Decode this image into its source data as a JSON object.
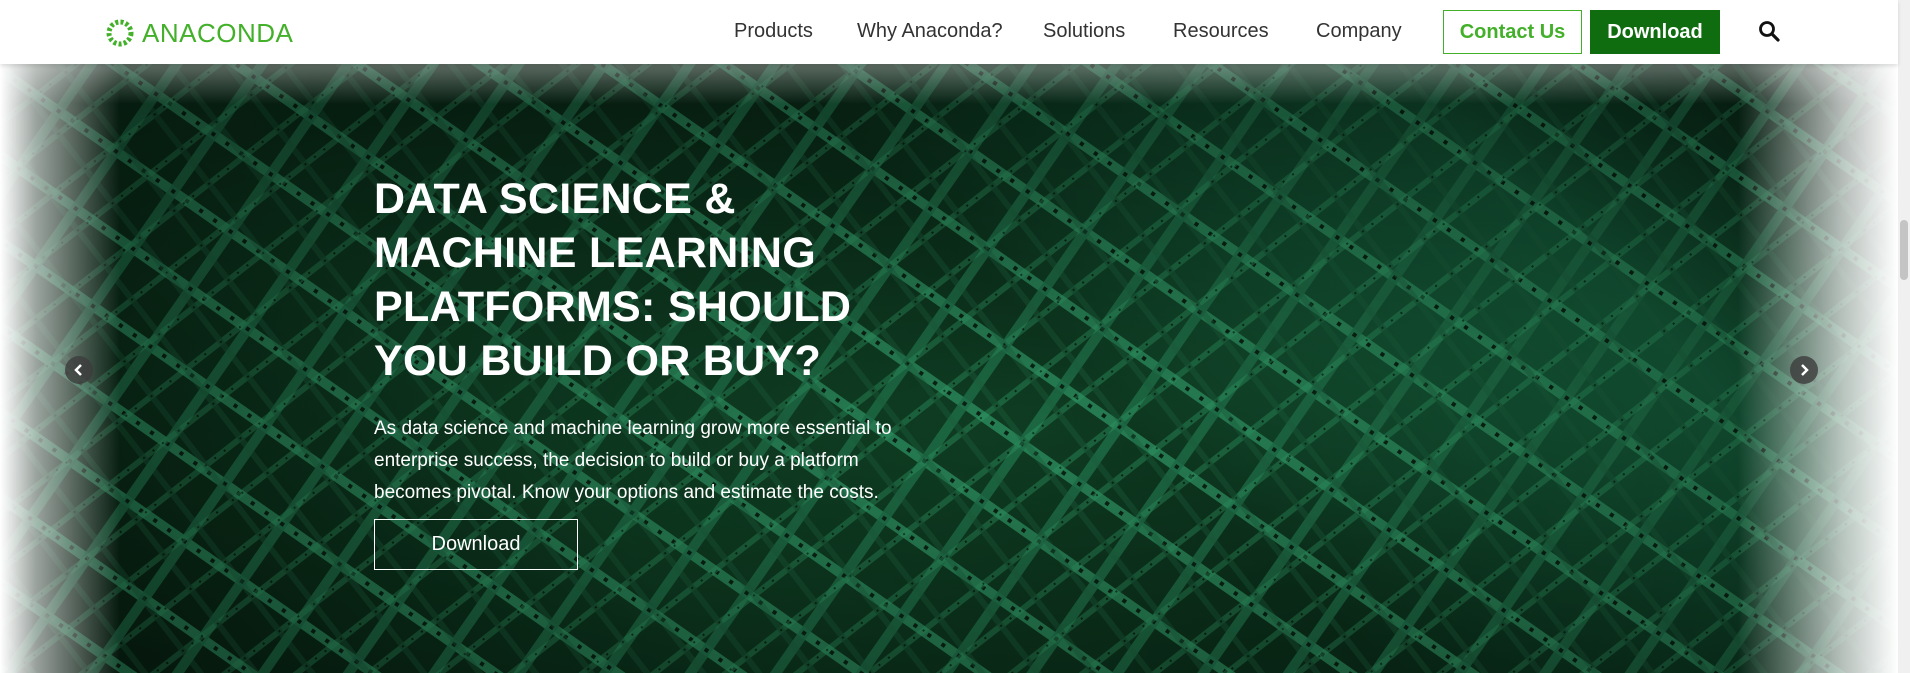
{
  "header": {
    "logo_text": "ANACONDA",
    "nav": [
      "Products",
      "Why Anaconda?",
      "Solutions",
      "Resources",
      "Company"
    ],
    "contact_label": "Contact Us",
    "download_label": "Download",
    "search_icon": "search-icon"
  },
  "hero": {
    "title": "DATA SCIENCE & MACHINE LEARNING PLATFORMS: SHOULD YOU BUILD OR BUY?",
    "body": "As data science and machine learning grow more essential to enterprise success, the decision to build or buy a platform becomes pivotal. Know your options and estimate the costs.",
    "button_label": "Download",
    "prev_icon": "chevron-left-icon",
    "next_icon": "chevron-right-icon"
  },
  "colors": {
    "brand": "#43b02a",
    "download_bg": "#0f6d0f",
    "hero_dark": "#0b2a17",
    "hero_light": "#1c7a4f"
  }
}
